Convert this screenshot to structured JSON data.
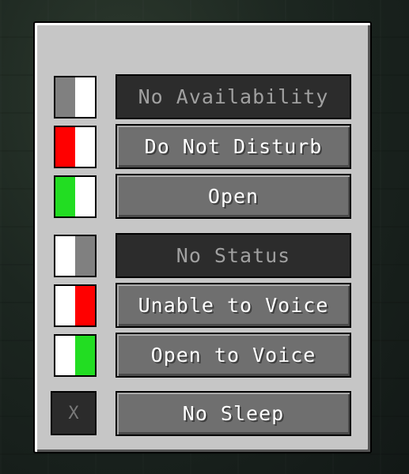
{
  "availability": [
    {
      "label": "No Availability",
      "swatch": [
        "#808080",
        "#ffffff"
      ],
      "enabled": false
    },
    {
      "label": "Do Not Disturb",
      "swatch": [
        "#ff0000",
        "#ffffff"
      ],
      "enabled": true
    },
    {
      "label": "Open",
      "swatch": [
        "#22dd22",
        "#ffffff"
      ],
      "enabled": true
    }
  ],
  "status": [
    {
      "label": "No Status",
      "swatch": [
        "#ffffff",
        "#808080"
      ],
      "enabled": false
    },
    {
      "label": "Unable to Voice",
      "swatch": [
        "#ffffff",
        "#ff0000"
      ],
      "enabled": true
    },
    {
      "label": "Open to Voice",
      "swatch": [
        "#ffffff",
        "#22dd22"
      ],
      "enabled": true
    }
  ],
  "sleep": {
    "icon_text": "X",
    "label": "No Sleep"
  }
}
